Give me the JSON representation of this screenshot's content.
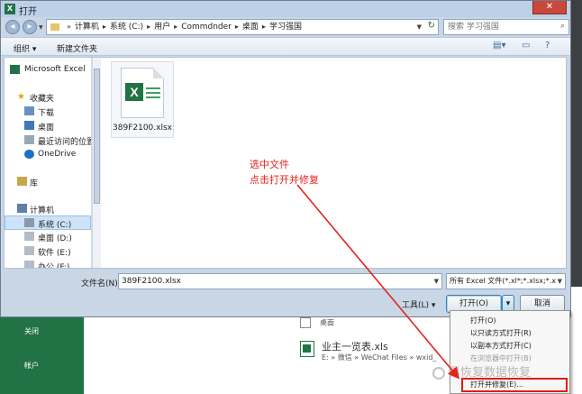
{
  "background": {
    "nav_close": "关闭",
    "nav_account": "帐户",
    "row2_label": "桌面",
    "recent_file_name": "业主一览表.xls",
    "recent_file_path": "E: » 微信 » WeChat Files » wxid_"
  },
  "dialog": {
    "title": "打开",
    "close_glyph": "✕",
    "breadcrumbs": [
      "计算机",
      "系统 (C:)",
      "用户",
      "Commdnder",
      "桌面",
      "学习强国"
    ],
    "search_placeholder": "搜索 学习强国",
    "toolbar": {
      "organize": "组织 ▾",
      "new_folder": "新建文件夹"
    },
    "nav": {
      "excel": "Microsoft Excel",
      "favorites": "收藏夹",
      "downloads": "下载",
      "desktop": "桌面",
      "recent": "最近访问的位置",
      "onedrive": "OneDrive",
      "libraries": "库",
      "computer": "计算机",
      "drive_c": "系统 (C:)",
      "drive_d": "桌面 (D:)",
      "drive_e": "软件 (E:)",
      "drive_f": "办公 (F:)"
    },
    "file": {
      "name": "389F2100.xlsx",
      "badge": "X"
    },
    "annotation": {
      "line1": "选中文件",
      "line2": "点击打开并修复"
    },
    "filename_label": "文件名(N):",
    "filename_value": "389F2100.xlsx",
    "filetype_value": "所有 Excel 文件(*.xl*;*.xlsx;*.xl",
    "tools_label": "工具(L)  ▾",
    "open_label": "打开(O)",
    "open_split": "▾",
    "cancel_label": "取消"
  },
  "open_menu": [
    {
      "label": "打开(O)",
      "enabled": true
    },
    {
      "label": "以只读方式打开(R)",
      "enabled": true
    },
    {
      "label": "以副本方式打开(C)",
      "enabled": true
    },
    {
      "label": "在浏览器中打开(B)",
      "enabled": false
    },
    {
      "label": "打开并修复(E)...",
      "enabled": true
    }
  ],
  "watermark": "易恢复数据恢复",
  "colors": {
    "excel_green": "#217346",
    "annotation_red": "#e8231b",
    "highlight_border": "#e01e12"
  }
}
